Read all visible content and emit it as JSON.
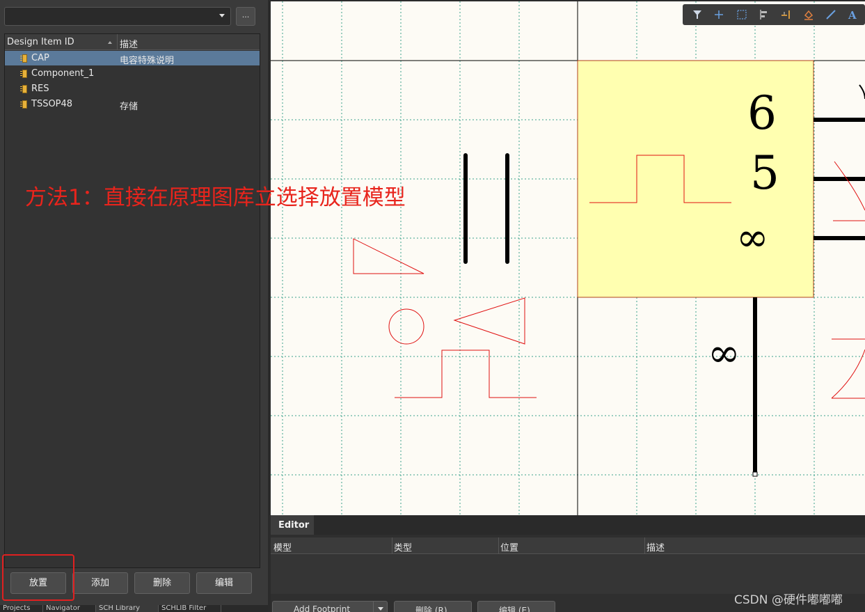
{
  "library_selector": {
    "value": "",
    "more_label": "..."
  },
  "list": {
    "headers": {
      "id": "Design Item ID",
      "description": "描述"
    },
    "items": [
      {
        "id": "CAP",
        "description": "电容特殊说明",
        "selected": true
      },
      {
        "id": "Component_1",
        "description": ""
      },
      {
        "id": "RES",
        "description": ""
      },
      {
        "id": "TSSOP48",
        "description": "存储"
      }
    ]
  },
  "buttons": {
    "place": "放置",
    "add": "添加",
    "delete": "删除",
    "edit": "编辑"
  },
  "bottom_tabs": [
    "Projects",
    "Navigator",
    "SCH Library",
    "SCHLIB Filter"
  ],
  "annotation": "方法1：直接在原理图库立选择放置模型",
  "canvas": {
    "pin_labels": [
      "6",
      "5",
      "∞",
      "∞"
    ]
  },
  "toolbar_icons": [
    "filter-icon",
    "crosshair-icon",
    "select-rect-icon",
    "align-icon",
    "pin-icon",
    "fill-icon",
    "line-icon",
    "text-icon"
  ],
  "editor": {
    "tab": "Editor",
    "headers": [
      "模型",
      "类型",
      "位置",
      "描述"
    ],
    "buttons": {
      "add_footprint": "Add Footprint",
      "delete": "删除 (R)",
      "edit": "编辑 (E)..."
    }
  },
  "watermark": "CSDN @硬件嘟嘟嘟",
  "colors": {
    "selection": "#5b7a9a",
    "highlight": "#e02020",
    "component_body": "#ffffb0",
    "graphic_red": "#e01010"
  }
}
